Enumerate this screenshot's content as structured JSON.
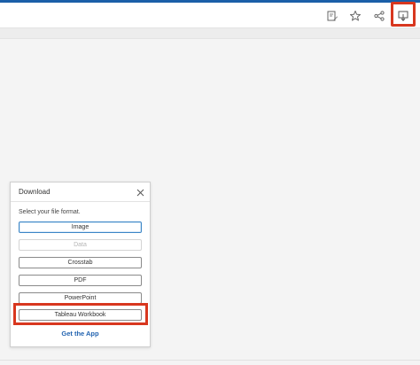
{
  "toolbar": {
    "icons": [
      "edit-sheet-icon",
      "star-icon",
      "share-icon",
      "download-icon"
    ],
    "accent_color": "#1b5fa8",
    "highlight_color": "#d8371f"
  },
  "download_panel": {
    "title": "Download",
    "prompt": "Select your file format.",
    "formats": [
      {
        "label": "Image",
        "state": "selected"
      },
      {
        "label": "Data",
        "state": "disabled"
      },
      {
        "label": "Crosstab",
        "state": "enabled"
      },
      {
        "label": "PDF",
        "state": "enabled"
      },
      {
        "label": "PowerPoint",
        "state": "enabled"
      },
      {
        "label": "Tableau Workbook",
        "state": "enabled"
      }
    ],
    "get_app_label": "Get the App",
    "link_color": "#2263b0"
  }
}
